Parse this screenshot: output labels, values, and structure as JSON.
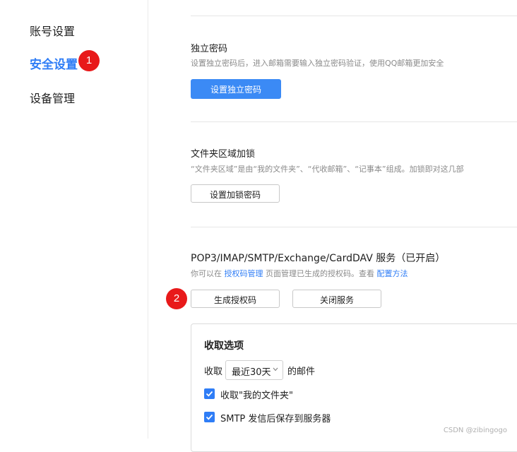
{
  "sidebar": {
    "items": [
      {
        "label": "账号设置"
      },
      {
        "label": "安全设置"
      },
      {
        "label": "设备管理"
      }
    ]
  },
  "markers": {
    "one": "1",
    "two": "2"
  },
  "password_section": {
    "title": "独立密码",
    "desc": "设置独立密码后，进入邮箱需要输入独立密码验证，使用QQ邮箱更加安全",
    "button": "设置独立密码"
  },
  "folder_lock_section": {
    "title": "文件夹区域加锁",
    "desc": "“文件夹区域”是由“我的文件夹”、“代收邮箱”、“记事本”组成。加锁即对这几部",
    "button": "设置加锁密码"
  },
  "service_section": {
    "title": "POP3/IMAP/SMTP/Exchange/CardDAV 服务（已开启）",
    "desc_prefix": "你可以在 ",
    "auth_link": "授权码管理",
    "desc_middle": " 页面管理已生成的授权码。查看 ",
    "config_link": "配置方法",
    "generate_button": "生成授权码",
    "close_button": "关闭服务"
  },
  "receive_options": {
    "title": "收取选项",
    "receive_label": "收取",
    "range_value": "最近30天",
    "mail_suffix": "的邮件",
    "checkbox_my_folders": "收取\"我的文件夹\"",
    "checkbox_smtp_save": "SMTP 发信后保存到服务器"
  },
  "watermark": "CSDN @zibingogo",
  "colors": {
    "accent": "#2f7df6",
    "marker": "#e8191a"
  }
}
